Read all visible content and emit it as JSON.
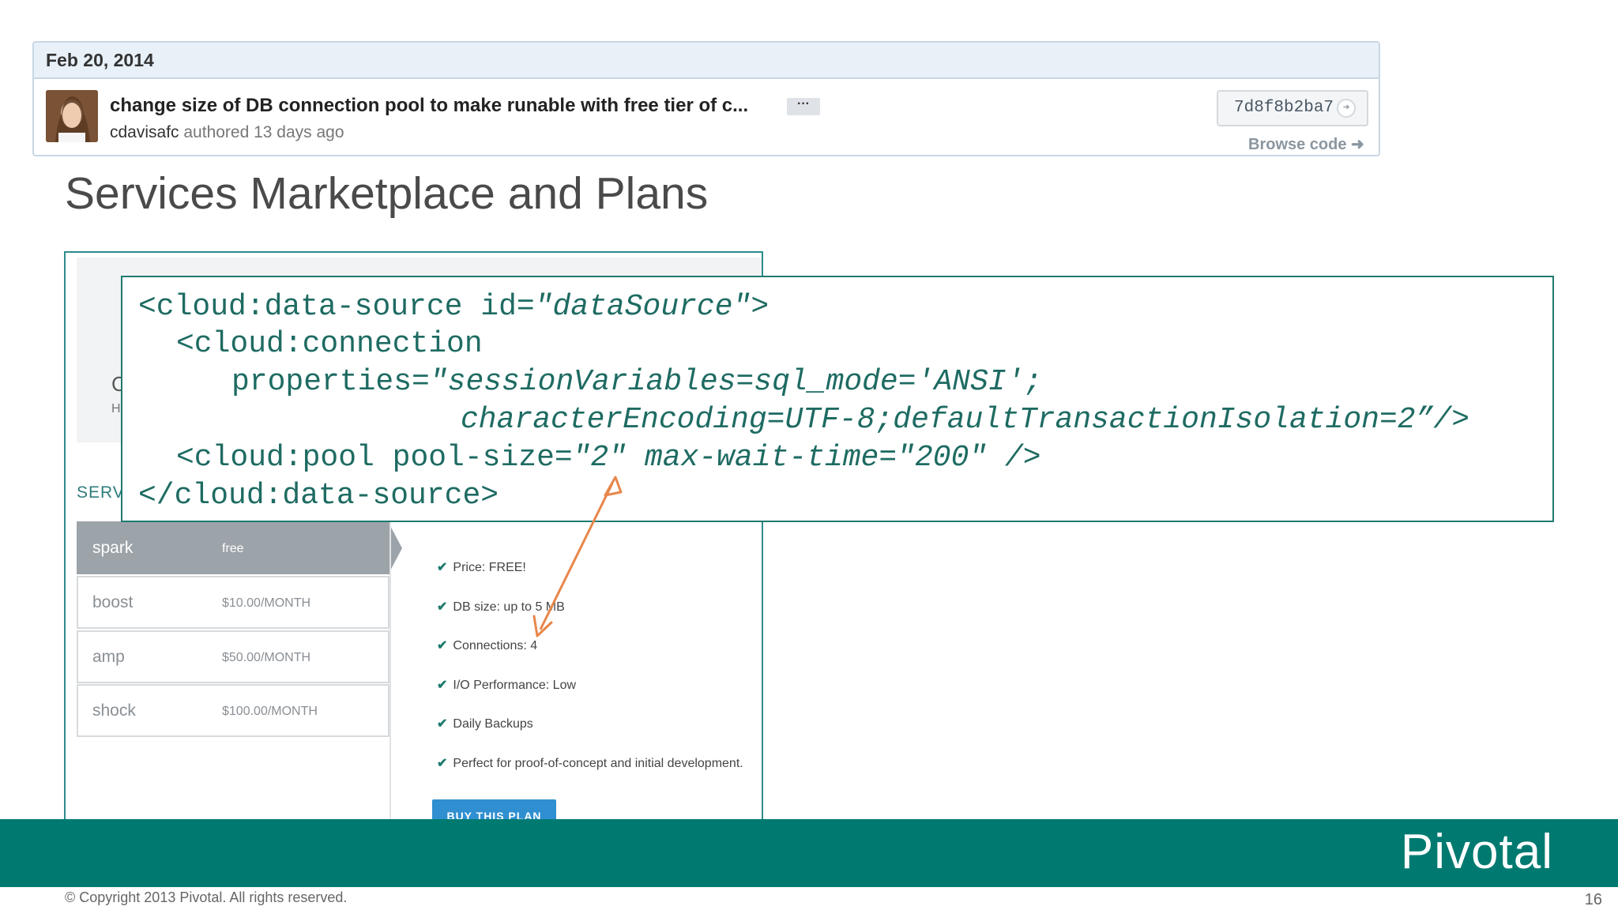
{
  "commit": {
    "date": "Feb 20, 2014",
    "message": "change size of DB connection pool to make runable with free tier of c...",
    "ellipsis": "···",
    "author": "cdavisafc",
    "authored": " authored 13 days ago",
    "sha": "7d8f8b2ba7",
    "browse_code": "Browse code ➜"
  },
  "slide": {
    "title": "Services Marketplace and Plans",
    "copyright": "© Copyright 2013 Pivotal. All rights reserved.",
    "page_number": "16",
    "logo": "Pivotal"
  },
  "market": {
    "banner_c": "C",
    "banner_h": "Hi",
    "services_label": "SERV",
    "plans": [
      {
        "name": "spark",
        "price": "free"
      },
      {
        "name": "boost",
        "price": "$10.00/MONTH"
      },
      {
        "name": "amp",
        "price": "$50.00/MONTH"
      },
      {
        "name": "shock",
        "price": "$100.00/MONTH"
      }
    ],
    "features": [
      "Price: FREE!",
      "DB size: up to 5 MB",
      "Connections: 4",
      "I/O Performance: Low",
      "Daily Backups",
      "Perfect for proof-of-concept and initial development."
    ],
    "buy_button": "BUY THIS PLAN"
  },
  "code": {
    "line1a": "<cloud:data-source id=",
    "line1b": "\"dataSource\"",
    "line1c": ">",
    "line2": "<cloud:connection",
    "line3a": "properties=",
    "line3b": "\"sessionVariables=sql_mode='ANSI';",
    "line4": "characterEncoding=UTF-8;defaultTransactionIsolation=2”/>",
    "line5a": "<cloud:pool pool-size=",
    "line5b": "\"2\" max-wait-time=\"200\" />",
    "line6": "</cloud:data-source>"
  },
  "colors": {
    "teal": "#007a70",
    "code_text": "#1e6b62",
    "arrow": "#e8864a",
    "buy_button": "#2f8fd1"
  }
}
